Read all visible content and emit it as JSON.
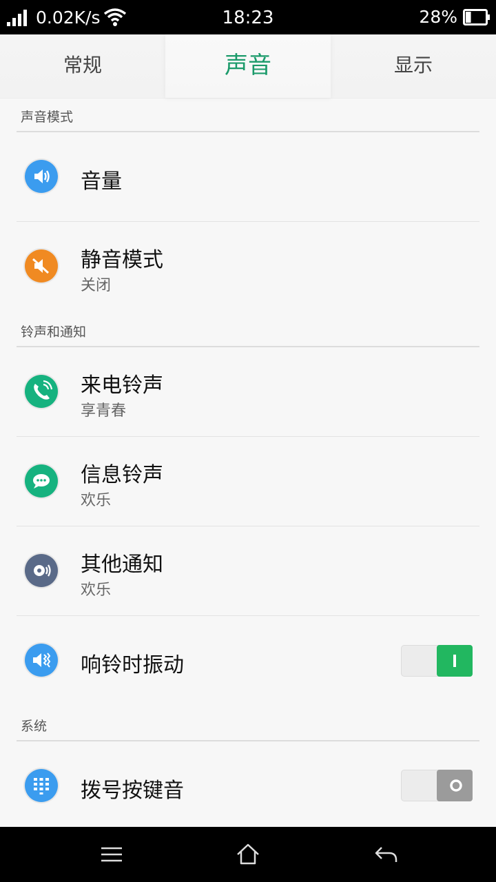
{
  "status_bar": {
    "net_speed": "0.02K/s",
    "time": "18:23",
    "battery_percent": "28%",
    "battery_level": 0.28,
    "icons": [
      "signal-icon",
      "wifi-icon",
      "battery-icon"
    ]
  },
  "tabs": [
    {
      "label": "常规",
      "selected": false
    },
    {
      "label": "声音",
      "selected": true
    },
    {
      "label": "显示",
      "selected": false
    }
  ],
  "colors": {
    "accent": "#1a9a6a",
    "toggle_on": "#22b760",
    "toggle_off": "#9b9b9b"
  },
  "sections": {
    "sound_mode": {
      "header": "声音模式",
      "volume": {
        "title": "音量",
        "icon": "volume-icon",
        "icon_color": "#3b9cef"
      },
      "silent": {
        "title": "静音模式",
        "subtitle": "关闭",
        "icon": "mute-icon",
        "icon_color": "#f08a22"
      }
    },
    "ringtones": {
      "header": "铃声和通知",
      "call": {
        "title": "来电铃声",
        "subtitle": "享青春",
        "icon": "phone-ring-icon",
        "icon_color": "#16b27f"
      },
      "message": {
        "title": "信息铃声",
        "subtitle": "欢乐",
        "icon": "message-icon",
        "icon_color": "#16b27f"
      },
      "other": {
        "title": "其他通知",
        "subtitle": "欢乐",
        "icon": "notification-icon",
        "icon_color": "#5a6a88"
      },
      "vibrate": {
        "title": "响铃时振动",
        "icon": "vibrate-icon",
        "icon_color": "#3b9cef",
        "enabled": true
      }
    },
    "system": {
      "header": "系统",
      "dialpad": {
        "title": "拨号按键音",
        "icon": "dialpad-icon",
        "icon_color": "#3b9cef",
        "enabled": false
      }
    }
  },
  "nav_bar": {
    "icons": [
      "menu-icon",
      "home-icon",
      "back-icon"
    ]
  }
}
